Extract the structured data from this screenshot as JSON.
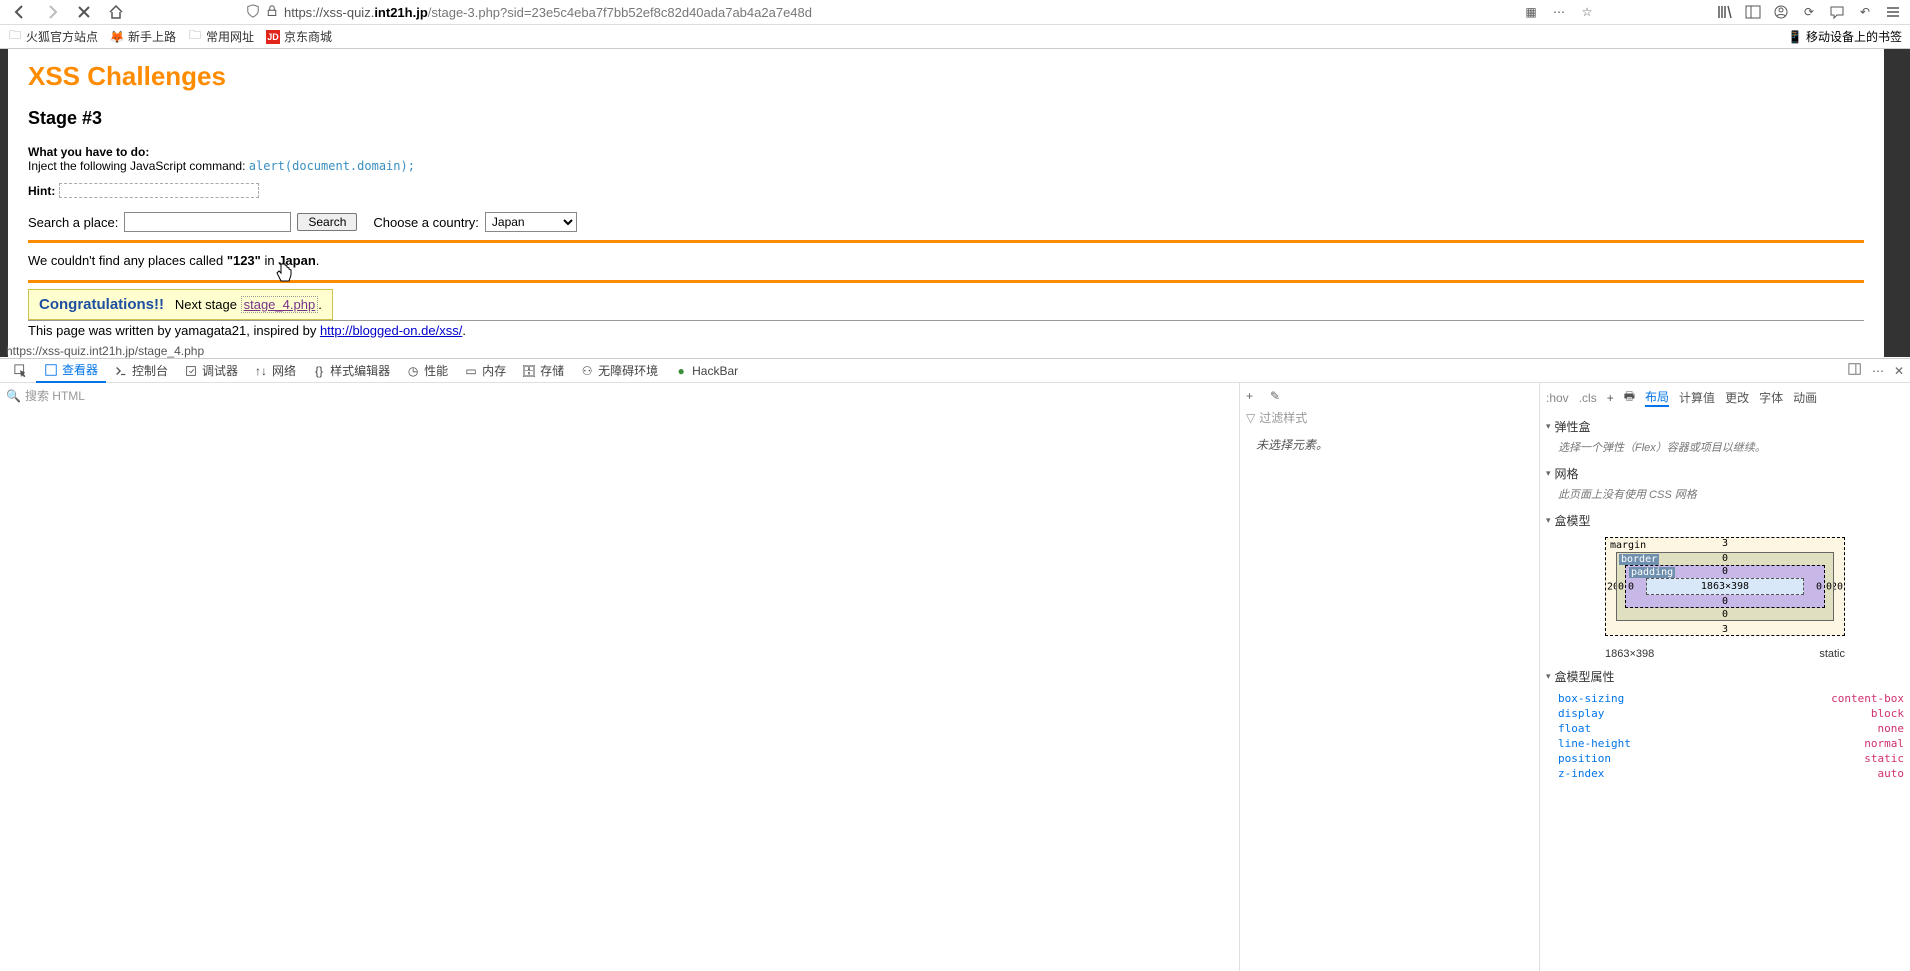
{
  "browser": {
    "url_proto": "https",
    "url_host": "://xss-quiz.",
    "url_domain": "int21h.jp",
    "url_path": "/stage-3.php?sid=23e5c4eba7f7bb52ef8c82d40ada7ab4a2a7e48d",
    "bookmarks": [
      "火狐官方站点",
      "新手上路",
      "常用网址",
      "京东商城"
    ],
    "bm_right": "移动设备上的书签",
    "status_url": "https://xss-quiz.int21h.jp/stage_4.php"
  },
  "page": {
    "title": "XSS Challenges",
    "stage": "Stage #3",
    "instr_label": "What you have to do:",
    "instr_text": "Inject the following JavaScript command: ",
    "instr_code": "alert(document.domain);",
    "hint_label": "Hint:",
    "search_label": "Search a place:",
    "search_value": "",
    "search_btn": "Search",
    "country_label": "Choose a country:",
    "country_value": "Japan",
    "result_prefix": "We couldn't find any places called ",
    "result_query": "\"123\"",
    "result_mid": " in ",
    "result_country": "Japan",
    "result_suffix": ".",
    "congrats": "Congratulations!!",
    "next_stage_label": "Next stage ",
    "next_stage_link": "stage_4.php",
    "footer_text": "This page was written by yamagata21, inspired by ",
    "footer_link": "http://blogged-on.de/xss/",
    "footer_end": "."
  },
  "devtools": {
    "tabs": [
      "查看器",
      "控制台",
      "调试器",
      "网络",
      "样式编辑器",
      "性能",
      "内存",
      "存储",
      "无障碍环境",
      "HackBar"
    ],
    "active_tab": 0,
    "search_placeholder": "搜索 HTML",
    "mid_filter": "过滤样式",
    "no_selection": "未选择元素。",
    "right_small": [
      ":hov",
      ".cls"
    ],
    "right_tabs": [
      "布局",
      "计算值",
      "更改",
      "字体",
      "动画"
    ],
    "right_active": 0,
    "sections": {
      "flex_h": "弹性盒",
      "flex_body": "选择一个弹性（Flex）容器或项目以继续。",
      "grid_h": "网格",
      "grid_body": "此页面上没有使用 CSS 网格",
      "boxmodel_h": "盒模型",
      "boxprops_h": "盒模型属性"
    },
    "boxmodel": {
      "margin": "margin",
      "border": "border",
      "padding": "padding",
      "content": "1863×398",
      "margin_t": "3",
      "margin_r": "20",
      "margin_b": "3",
      "margin_l": "20",
      "border_t": "0",
      "border_r": "0",
      "border_b": "0",
      "border_l": "0",
      "padding_t": "0",
      "padding_r": "0",
      "padding_b": "0",
      "padding_l": "0",
      "dims": "1863×398",
      "pos": "static",
      "props": [
        {
          "k": "box-sizing",
          "v": "content-box"
        },
        {
          "k": "display",
          "v": "block"
        },
        {
          "k": "float",
          "v": "none"
        },
        {
          "k": "line-height",
          "v": "normal"
        },
        {
          "k": "position",
          "v": "static"
        },
        {
          "k": "z-index",
          "v": "auto"
        }
      ]
    }
  }
}
